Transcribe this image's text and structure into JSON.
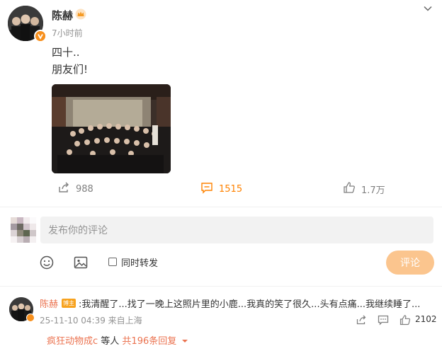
{
  "post": {
    "username": "陈赫",
    "time": "7小时前",
    "text_lines": [
      "四十..",
      "朋友们!"
    ],
    "badge_icon": "crown-icon",
    "verified_color": "#f7901e"
  },
  "actions": {
    "repost_count": "988",
    "comment_count": "1515",
    "like_count": "1.7万",
    "active_color": "#ff8200"
  },
  "composer": {
    "placeholder": "发布你的评论",
    "forward_label": "同时转发",
    "submit_label": "评论",
    "submit_color": "#fbc58e"
  },
  "comment": {
    "username": "陈赫",
    "host_tag": "博主",
    "text": ":我清醒了...找了一晚上这照片里的小鹿...我真的笑了很久...头有点痛...我继续睡了...",
    "meta": "25-11-10 04:39 来自上海",
    "like_count": "2102",
    "reply_user": "疯狂动物成c",
    "reply_middle": " 等人 ",
    "reply_count": "共196条回复"
  }
}
